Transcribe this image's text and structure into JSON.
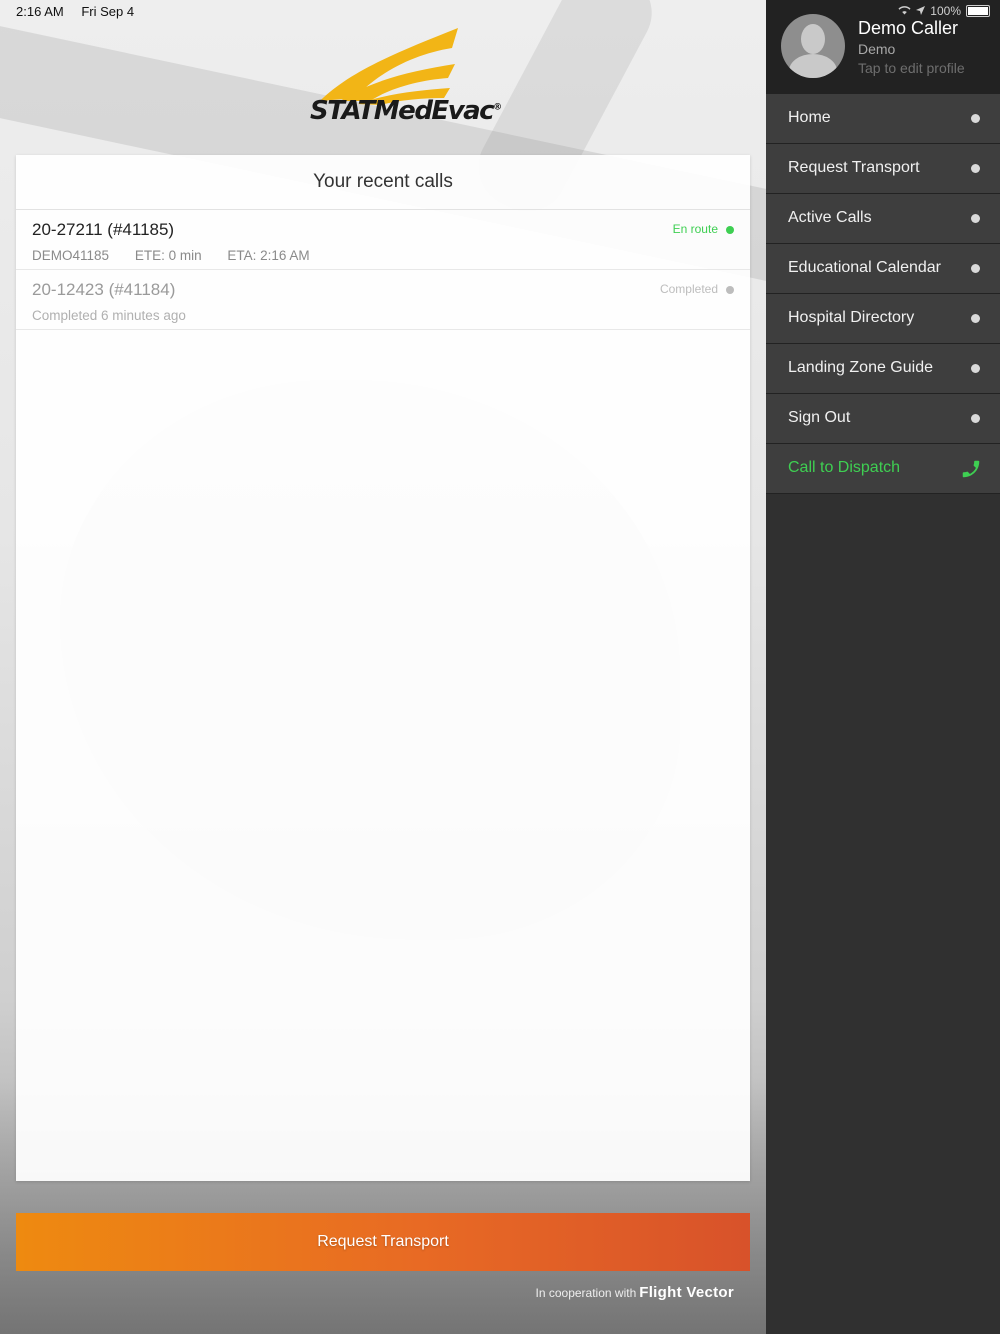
{
  "status_bar": {
    "time": "2:16 AM",
    "date": "Fri Sep 4",
    "battery": "100%"
  },
  "logo": {
    "text": "STATMedEvac",
    "mark": "®"
  },
  "recent_calls": {
    "title": "Your recent calls",
    "calls": [
      {
        "id": "20-27211 (#41185)",
        "sub1": "DEMO41185",
        "sub2": "ETE: 0 min",
        "sub3": "ETA: 2:16 AM",
        "status": "En route",
        "status_color": "#3ecf52"
      },
      {
        "id": "20-12423 (#41184)",
        "sub1": "Completed 6 minutes ago",
        "sub2": "",
        "sub3": "",
        "status": "Completed",
        "status_color": "#bdbdbd"
      }
    ]
  },
  "request_button": {
    "label": "Request Transport"
  },
  "footer": {
    "prefix": "In cooperation with",
    "brand": "Flight Vector"
  },
  "profile": {
    "name": "Demo Caller",
    "role": "Demo",
    "edit": "Tap to edit profile"
  },
  "menu": {
    "items": [
      {
        "label": "Home"
      },
      {
        "label": "Request Transport"
      },
      {
        "label": "Active Calls"
      },
      {
        "label": "Educational Calendar"
      },
      {
        "label": "Hospital Directory"
      },
      {
        "label": "Landing Zone Guide"
      },
      {
        "label": "Sign Out"
      }
    ],
    "dispatch": {
      "label": "Call to Dispatch",
      "icon": "phone-icon",
      "color": "#3ecf52"
    }
  },
  "colors": {
    "accent_orange": "#ee8a10",
    "accent_red": "#d8522a",
    "success_green": "#3ecf52",
    "sidebar_bg": "#303030"
  }
}
